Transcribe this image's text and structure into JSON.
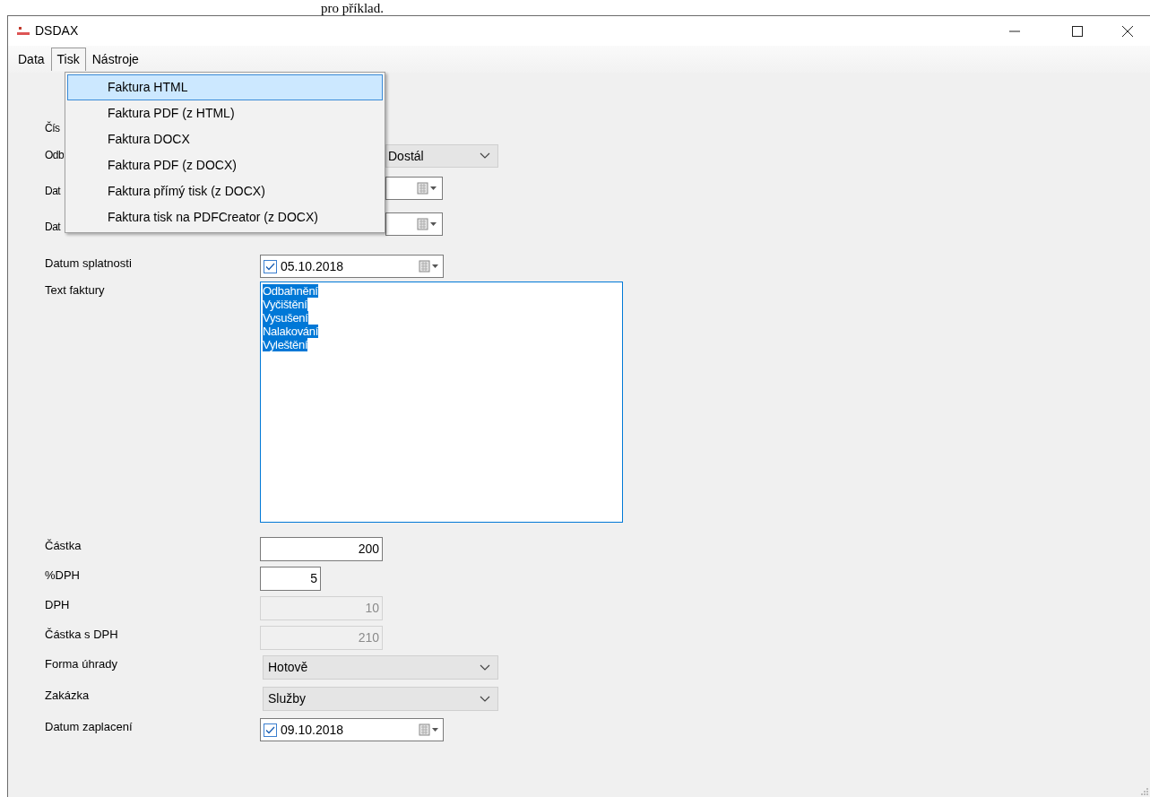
{
  "page_text_above": "pro příklad.",
  "window": {
    "title": "DSDAX"
  },
  "menu_bar": [
    {
      "label": "Data",
      "selected": false
    },
    {
      "label": "Tisk",
      "selected": true
    },
    {
      "label": "Nástroje",
      "selected": false
    }
  ],
  "dropdown_menu": [
    {
      "label": "Faktura HTML",
      "selected": true
    },
    {
      "label": "Faktura PDF (z HTML)",
      "selected": false
    },
    {
      "label": "Faktura DOCX",
      "selected": false
    },
    {
      "label": "Faktura PDF (z DOCX)",
      "selected": false
    },
    {
      "label": "Faktura přímý tisk (z DOCX)",
      "selected": false
    },
    {
      "label": "Faktura tisk na PDFCreator (z DOCX)",
      "selected": false
    }
  ],
  "form": [
    {
      "label": "Čís",
      "kind": "none"
    },
    {
      "label": "Odb",
      "kind": "combo_tail",
      "value": "Dostál"
    },
    {
      "label": "Dat",
      "kind": "date_tail"
    },
    {
      "label": "Dat",
      "kind": "date_tail"
    },
    {
      "label": "Datum splatnosti",
      "kind": "date",
      "checked": true,
      "value": "05.10.2018"
    },
    {
      "label": "Text faktury",
      "kind": "textarea",
      "selected": true,
      "lines": [
        "Odbahnění",
        "Vyčištění",
        "Vysušení",
        "Nalakování",
        "Vyleštění"
      ]
    },
    {
      "label": "Částka",
      "kind": "number",
      "disabled": false,
      "value": "200"
    },
    {
      "label": "%DPH",
      "kind": "small_number",
      "disabled": false,
      "value": "5"
    },
    {
      "label": "DPH",
      "kind": "number",
      "disabled": true,
      "value": "10"
    },
    {
      "label": "Částka s DPH",
      "kind": "number",
      "disabled": true,
      "value": "210"
    },
    {
      "label": "Forma úhrady",
      "kind": "combo",
      "value": "Hotově"
    },
    {
      "label": "Zakázka",
      "kind": "combo",
      "value": "Služby"
    },
    {
      "label": "Datum zaplacení",
      "kind": "date",
      "checked": true,
      "value": "09.10.2018"
    }
  ]
}
